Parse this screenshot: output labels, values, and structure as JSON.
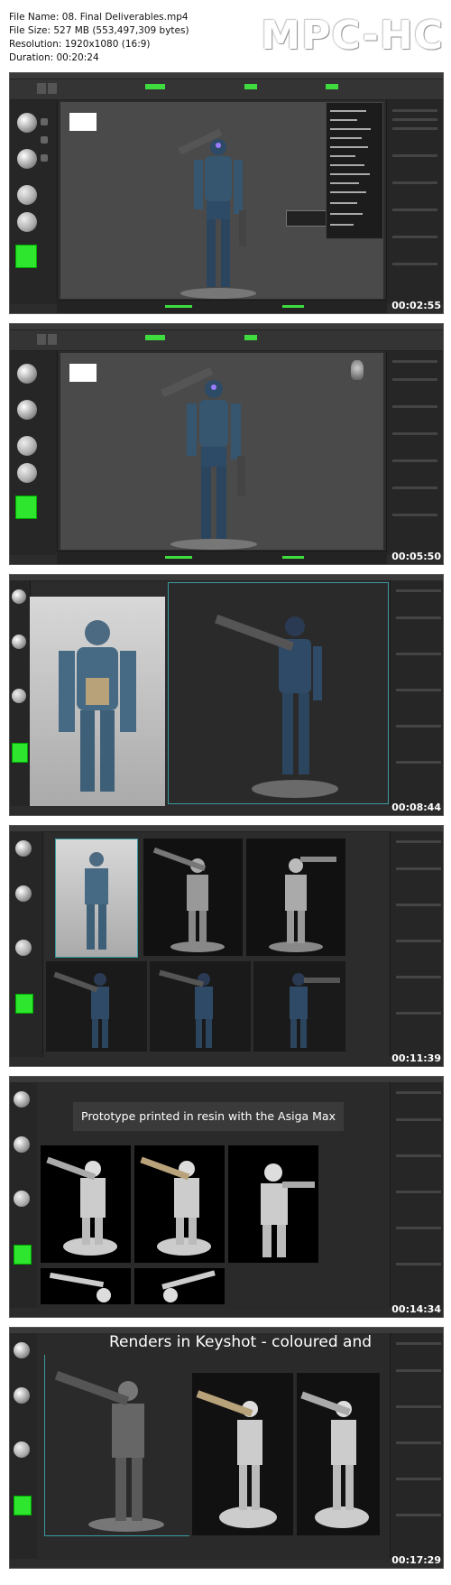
{
  "header": {
    "file_name": "File Name: 08. Final Deliverables.mp4",
    "file_size": "File Size: 527 MB (553,497,309 bytes)",
    "resolution": "Resolution: 1920x1080 (16:9)",
    "duration": "Duration: 00:20:24",
    "logo": "MPC-HC"
  },
  "frames": [
    {
      "timestamp": "00:02:55"
    },
    {
      "timestamp": "00:05:50"
    },
    {
      "timestamp": "00:08:44"
    },
    {
      "timestamp": "00:11:39"
    },
    {
      "timestamp": "00:14:34",
      "banner": "Prototype printed in resin with the Asiga Max"
    },
    {
      "timestamp": "00:17:29",
      "title": "Renders in Keyshot - coloured and"
    }
  ],
  "colors": {
    "accent_green": "#3fdc3f",
    "panel": "#262626",
    "viewport": "#4a4a4a"
  }
}
